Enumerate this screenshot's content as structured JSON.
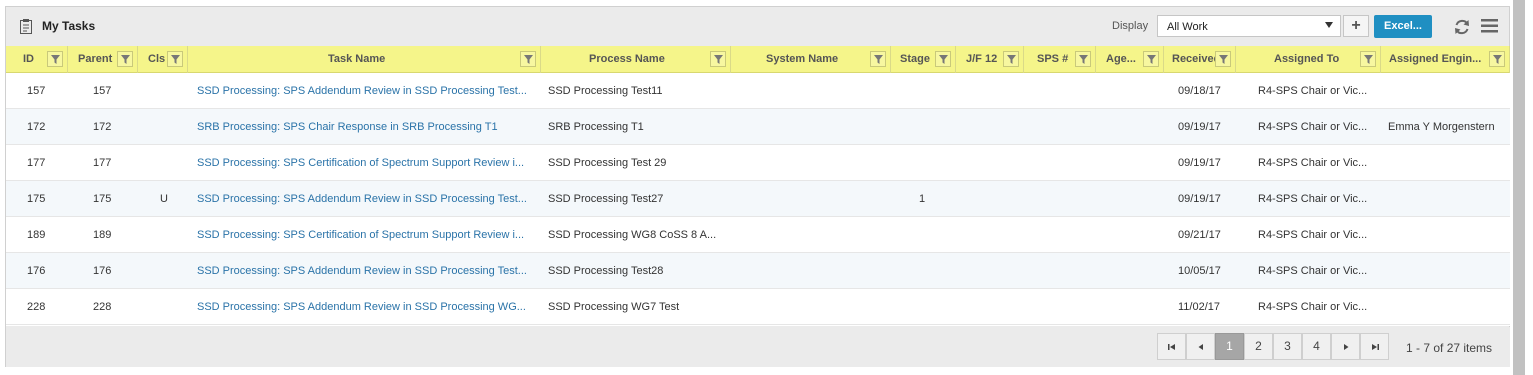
{
  "title": "My Tasks",
  "toolbar": {
    "display_label": "Display",
    "display_value": "All Work",
    "add_label": "+",
    "excel_label": "Excel...",
    "accent": "#1f8fc2"
  },
  "columns": [
    "ID",
    "Parent",
    "Cls",
    "Task Name",
    "Process Name",
    "System Name",
    "Stage",
    "J/F 12",
    "SPS #",
    "Age...",
    "Received",
    "Assigned To",
    "Assigned Engin..."
  ],
  "rows": [
    {
      "id": "157",
      "parent": "157",
      "cls": "",
      "task": "SSD Processing: SPS Addendum Review in SSD Processing Test...",
      "process": "SSD Processing Test11",
      "system": "",
      "stage": "",
      "jf": "",
      "sps": "",
      "age": "",
      "received": "09/18/17",
      "assigned": "R4-SPS Chair or Vic...",
      "engineer": ""
    },
    {
      "id": "172",
      "parent": "172",
      "cls": "",
      "task": "SRB Processing: SPS Chair Response in SRB Processing T1",
      "process": "SRB Processing T1",
      "system": "",
      "stage": "",
      "jf": "",
      "sps": "",
      "age": "",
      "received": "09/19/17",
      "assigned": "R4-SPS Chair or Vic...",
      "engineer": "Emma Y Morgenstern"
    },
    {
      "id": "177",
      "parent": "177",
      "cls": "",
      "task": "SSD Processing: SPS Certification of Spectrum Support Review i...",
      "process": "SSD Processing Test 29",
      "system": "",
      "stage": "",
      "jf": "",
      "sps": "",
      "age": "",
      "received": "09/19/17",
      "assigned": "R4-SPS Chair or Vic...",
      "engineer": ""
    },
    {
      "id": "175",
      "parent": "175",
      "cls": "U",
      "task": "SSD Processing: SPS Addendum Review in SSD Processing Test...",
      "process": "SSD Processing Test27",
      "system": "",
      "stage": "1",
      "jf": "",
      "sps": "",
      "age": "",
      "received": "09/19/17",
      "assigned": "R4-SPS Chair or Vic...",
      "engineer": ""
    },
    {
      "id": "189",
      "parent": "189",
      "cls": "",
      "task": "SSD Processing: SPS Certification of Spectrum Support Review i...",
      "process": "SSD Processing WG8 CoSS 8 A...",
      "system": "",
      "stage": "",
      "jf": "",
      "sps": "",
      "age": "",
      "received": "09/21/17",
      "assigned": "R4-SPS Chair or Vic...",
      "engineer": ""
    },
    {
      "id": "176",
      "parent": "176",
      "cls": "",
      "task": "SSD Processing: SPS Addendum Review in SSD Processing Test...",
      "process": "SSD Processing Test28",
      "system": "",
      "stage": "",
      "jf": "",
      "sps": "",
      "age": "",
      "received": "10/05/17",
      "assigned": "R4-SPS Chair or Vic...",
      "engineer": ""
    },
    {
      "id": "228",
      "parent": "228",
      "cls": "",
      "task": "SSD Processing: SPS Addendum Review in SSD Processing WG...",
      "process": "SSD Processing WG7 Test",
      "system": "",
      "stage": "",
      "jf": "",
      "sps": "",
      "age": "",
      "received": "11/02/17",
      "assigned": "R4-SPS Chair or Vic...",
      "engineer": ""
    }
  ],
  "pager": {
    "pages": [
      "1",
      "2",
      "3",
      "4"
    ],
    "current": "1",
    "info": "1 - 7 of 27 items"
  }
}
